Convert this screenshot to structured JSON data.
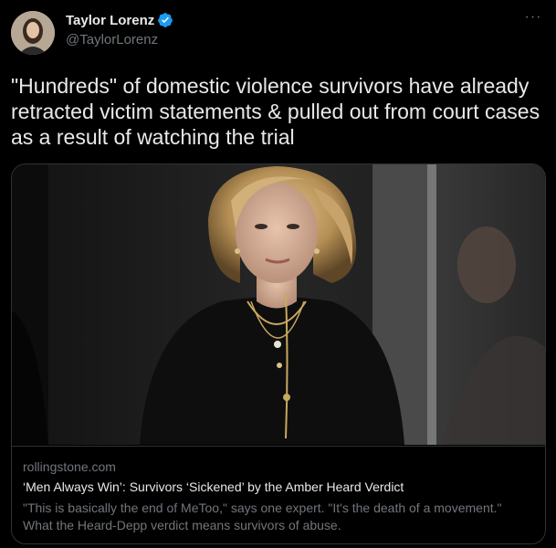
{
  "author": {
    "display_name": "Taylor Lorenz",
    "handle": "@TaylorLorenz",
    "verified_icon": "verified-badge-icon",
    "avatar": "profile-photo"
  },
  "menu": {
    "more_label": "···"
  },
  "tweet": {
    "text": "\"Hundreds\" of domestic violence survivors have already retracted victim statements & pulled out from court cases as a result of watching the trial"
  },
  "card": {
    "image": "photo-of-woman-in-black-top",
    "domain": "rollingstone.com",
    "headline": "‘Men Always Win’: Survivors ‘Sickened’ by the Amber Heard Verdict",
    "description": "\"This is basically the end of MeToo,\" says one expert. \"It's the death of a movement.\" What the Heard-Depp verdict means survivors of abuse."
  },
  "colors": {
    "background": "#000000",
    "text_primary": "#e7e9ea",
    "text_secondary": "#71767b",
    "border": "#2f3336",
    "verified_blue": "#1d9bf0"
  }
}
